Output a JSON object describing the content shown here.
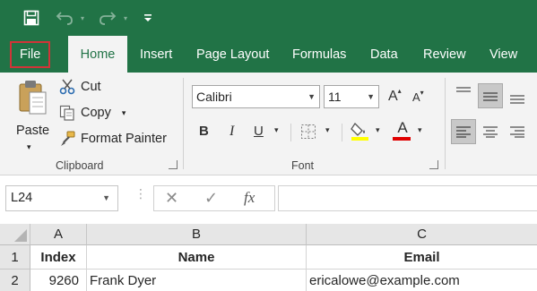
{
  "qat": {
    "icons": [
      "save-icon",
      "undo-icon",
      "redo-icon",
      "customize-qat-icon"
    ]
  },
  "tabs": [
    {
      "label": "File"
    },
    {
      "label": "Home"
    },
    {
      "label": "Insert"
    },
    {
      "label": "Page Layout"
    },
    {
      "label": "Formulas"
    },
    {
      "label": "Data"
    },
    {
      "label": "Review"
    },
    {
      "label": "View"
    }
  ],
  "active_tab": "Home",
  "ribbon": {
    "clipboard": {
      "paste": "Paste",
      "cut": "Cut",
      "copy": "Copy",
      "format_painter": "Format Painter",
      "group_label": "Clipboard"
    },
    "font": {
      "font_name": "Calibri",
      "font_size": "11",
      "bold": "B",
      "italic": "I",
      "underline": "U",
      "grow": "A",
      "shrink": "A",
      "font_color_letter": "A",
      "group_label": "Font",
      "highlight_color": "#ffff00",
      "font_color": "#e00000"
    }
  },
  "formula_bar": {
    "name_box": "L24",
    "fx": "fx",
    "value": ""
  },
  "sheet": {
    "columns": [
      "A",
      "B",
      "C"
    ],
    "rows": [
      {
        "num": "1",
        "cells": [
          "Index",
          "Name",
          "Email"
        ]
      },
      {
        "num": "2",
        "cells": [
          "9260",
          "Frank Dyer",
          "ericalowe@example.com"
        ]
      }
    ]
  },
  "colors": {
    "brand": "#217346",
    "file_tab_outline": "#d13438"
  }
}
